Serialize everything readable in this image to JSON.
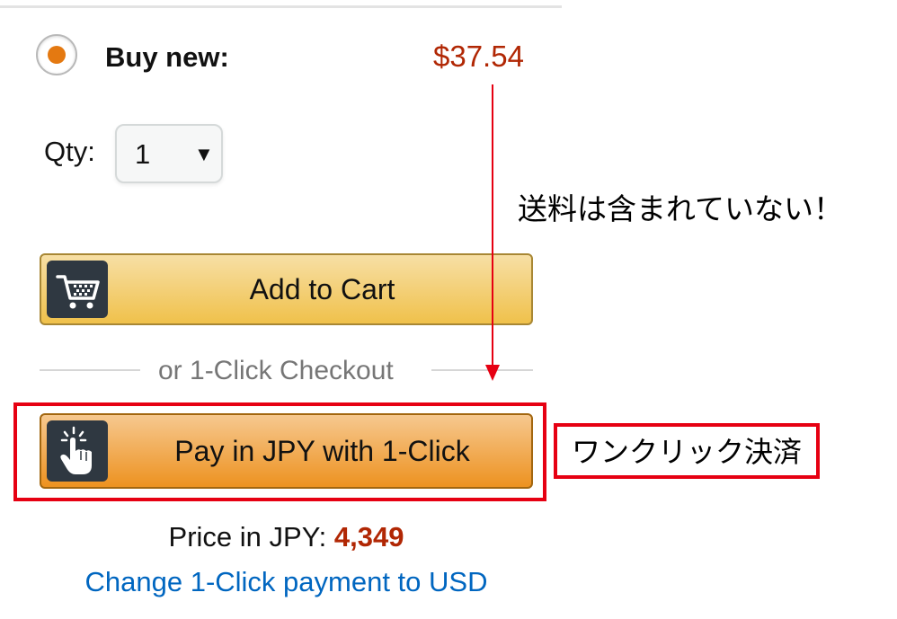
{
  "offer": {
    "buy_label": "Buy new:",
    "price": "$37.54",
    "selected": true
  },
  "quantity": {
    "label": "Qty:",
    "value": "1",
    "caret": "▼"
  },
  "buttons": {
    "add_to_cart": "Add to Cart",
    "pay_one_click": "Pay in JPY with 1-Click",
    "cart_icon": "cart-icon",
    "click_icon": "hand-click-icon"
  },
  "divider": {
    "text": "or 1-Click Checkout"
  },
  "jpy": {
    "label": "Price in JPY: ",
    "amount": "4,349"
  },
  "change_link": "Change 1-Click payment to USD",
  "annotations": {
    "shipping_note": "送料は含まれていない！",
    "one_click_label": "ワンクリック決済",
    "highlight_color": "#e60012"
  },
  "colors": {
    "price_red": "#b12704",
    "radio_orange": "#e47911",
    "link_blue": "#0066c0"
  }
}
